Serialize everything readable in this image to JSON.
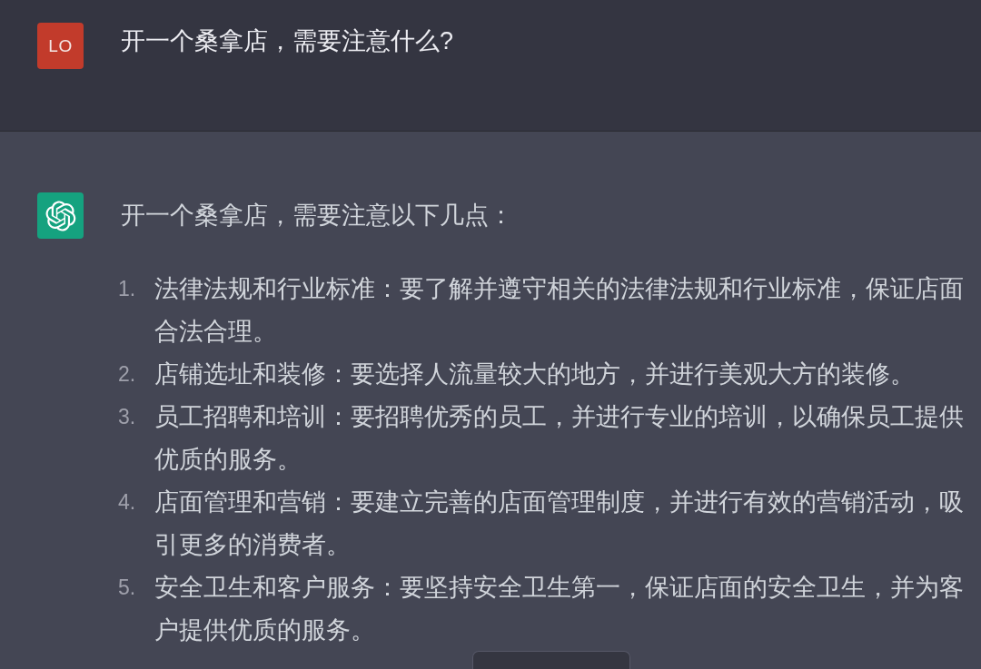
{
  "messages": [
    {
      "kind": "user",
      "avatar": "LO",
      "paragraphs": [
        "开一个桑拿店，需要注意什么?"
      ]
    },
    {
      "kind": "assistant",
      "paragraphs": [
        "开一个桑拿店，需要注意以下几点："
      ],
      "list": [
        {
          "number": "1.",
          "text": "法律法规和行业标准：要了解并遵守相关的法律法规和行业标准，保证店面合法合理。"
        },
        {
          "number": "2.",
          "text": "店铺选址和装修：要选择人流量较大的地方，并进行美观大方的装修。"
        },
        {
          "number": "3.",
          "text": "员工招聘和培训：要招聘优秀的员工，并进行专业的培训，以确保员工提供优质的服务。"
        },
        {
          "number": "4.",
          "text": "店面管理和营销：要建立完善的店面管理制度，并进行有效的营销活动，吸引更多的消费者。"
        },
        {
          "number": "5.",
          "text": "安全卫生和客户服务：要坚持安全卫生第一，保证店面的安全卫生，并为客户提供优质的服务。"
        }
      ]
    }
  ]
}
